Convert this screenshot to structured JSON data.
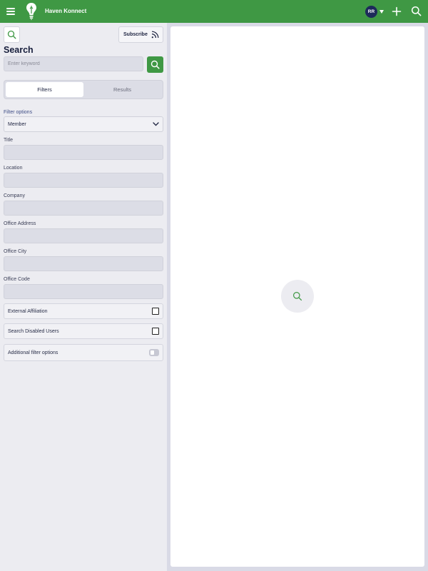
{
  "app": {
    "title": "Haven Konnect",
    "user_initials": "RR",
    "icons": {
      "menu": "hamburger-icon",
      "logo": "lightbulb-logo",
      "avatar_caret": "caret-down-icon",
      "add": "plus-icon",
      "search": "search-icon"
    }
  },
  "search": {
    "title": "Search",
    "subscribe_label": "Subscribe",
    "subscribe_icon": "rss-icon",
    "keyword_placeholder": "Enter keyword",
    "keyword_value": ""
  },
  "tabs": [
    {
      "label": "Filters",
      "active": true
    },
    {
      "label": "Results",
      "active": false
    }
  ],
  "filters": {
    "filter_options_label": "Filter options",
    "filter_options_value": "Member",
    "fields": [
      {
        "label": "Title",
        "value": ""
      },
      {
        "label": "Location",
        "value": ""
      },
      {
        "label": "Company",
        "value": ""
      },
      {
        "label": "Office Address",
        "value": ""
      },
      {
        "label": "Office City",
        "value": ""
      },
      {
        "label": "Office Code",
        "value": ""
      }
    ],
    "checkboxes": [
      {
        "label": "External Affiliation",
        "checked": false
      },
      {
        "label": "Search Disabled Users",
        "checked": false
      }
    ],
    "additional_options": {
      "label": "Additional filter options",
      "enabled": false
    }
  },
  "colors": {
    "brand_green": "#3f9844",
    "avatar_navy": "#1d2a5a",
    "heading_navy": "#161d3b",
    "panel_bg": "#ececf1",
    "page_bg": "#d9dae6"
  }
}
